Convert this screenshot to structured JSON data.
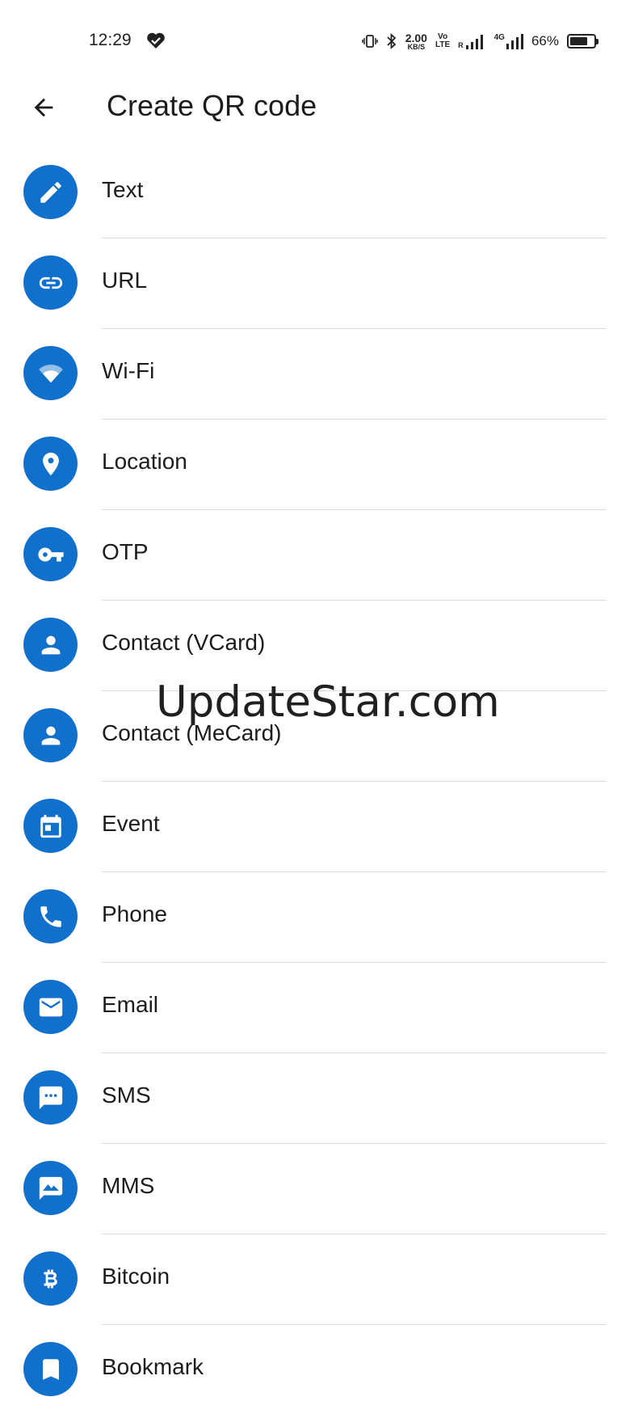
{
  "status_bar": {
    "time": "12:29",
    "speed_value": "2.00",
    "speed_unit": "KB/S",
    "volte_top": "Vo",
    "volte_bottom": "LTE",
    "roaming": "R",
    "network": "4G",
    "battery_percent_text": "66%",
    "battery_level": 0.66
  },
  "app_bar": {
    "title": "Create QR code",
    "back_icon": "arrow-back-icon"
  },
  "items": [
    {
      "label": "Text",
      "icon": "pencil-icon"
    },
    {
      "label": "URL",
      "icon": "link-icon"
    },
    {
      "label": "Wi-Fi",
      "icon": "wifi-icon"
    },
    {
      "label": "Location",
      "icon": "location-pin-icon"
    },
    {
      "label": "OTP",
      "icon": "key-icon"
    },
    {
      "label": "Contact (VCard)",
      "icon": "person-icon"
    },
    {
      "label": "Contact (MeCard)",
      "icon": "person-icon"
    },
    {
      "label": "Event",
      "icon": "calendar-icon"
    },
    {
      "label": "Phone",
      "icon": "phone-icon"
    },
    {
      "label": "Email",
      "icon": "envelope-icon"
    },
    {
      "label": "SMS",
      "icon": "sms-bubble-icon"
    },
    {
      "label": "MMS",
      "icon": "mms-bubble-icon"
    },
    {
      "label": "Bitcoin",
      "icon": "bitcoin-icon"
    },
    {
      "label": "Bookmark",
      "icon": "bookmark-icon"
    }
  ],
  "watermark": "UpdateStar.com",
  "colors": {
    "accent": "#1170cc",
    "text": "#1c1c1c",
    "divider": "#dddddd",
    "background": "#ffffff"
  }
}
